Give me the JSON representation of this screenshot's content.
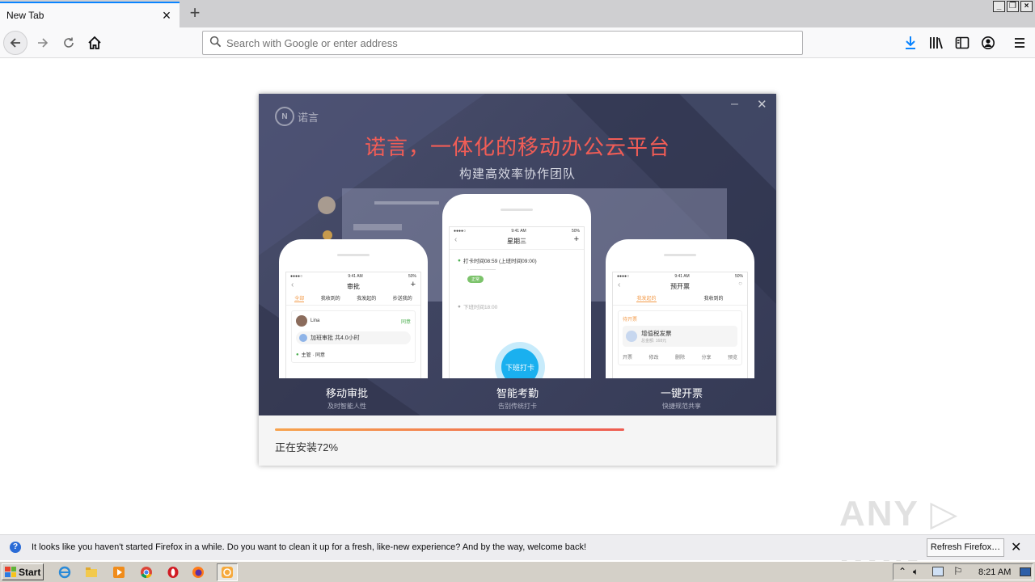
{
  "browser": {
    "tab_title": "New Tab",
    "url_placeholder": "Search with Google or enter address"
  },
  "installer": {
    "logo_text": "诺言",
    "logo_mark": "N",
    "headline": "诺言，一体化的移动办公云平台",
    "subheadline": "构建高效率协作团队",
    "phones": [
      {
        "time": "9:41 AM",
        "battery": "50%",
        "title": "审批",
        "tabs": [
          "全部",
          "我收到的",
          "我发起的",
          "抄送我的"
        ],
        "user": "Lina",
        "status": "同意",
        "item": "加班审批 共4.0小时",
        "approver": "主管 · 同意"
      },
      {
        "time": "9:41 AM",
        "battery": "50%",
        "title": "星期三",
        "checkin": "打卡时间08:59 (上班时间09:00)",
        "tag": "正常",
        "checkout": "下班时间18:00",
        "button": "下班打卡"
      },
      {
        "time": "9:41 AM",
        "battery": "50%",
        "title": "预开票",
        "tabs": [
          "我发起的",
          "我收到的"
        ],
        "status": "待开票",
        "invoice_title": "增值税发票",
        "invoice_amount": "总金额: 168元",
        "actions": [
          "开票",
          "修改",
          "删除",
          "分享",
          "预览"
        ]
      }
    ],
    "captions": [
      {
        "title": "移动审批",
        "sub": "及时智能人性"
      },
      {
        "title": "智能考勤",
        "sub": "告别传统打卡"
      },
      {
        "title": "一键开票",
        "sub": "快捷规范共享"
      }
    ],
    "progress": 0.72,
    "status_text": "正在安装72%"
  },
  "notification": {
    "message": "It looks like you haven't started Firefox in a while. Do you want to clean it up for a fresh, like-new experience? And by the way, welcome back!",
    "button": "Refresh Firefox…"
  },
  "watermark": "ANY RUN",
  "taskbar": {
    "start_label": "Start",
    "clock": "8:21 AM"
  },
  "colors": {
    "headline": "#f25d56",
    "banner": "#3f4461",
    "progress_start": "#f7a34d",
    "progress_end": "#ee5c51",
    "firefox_blue": "#0a84ff"
  }
}
